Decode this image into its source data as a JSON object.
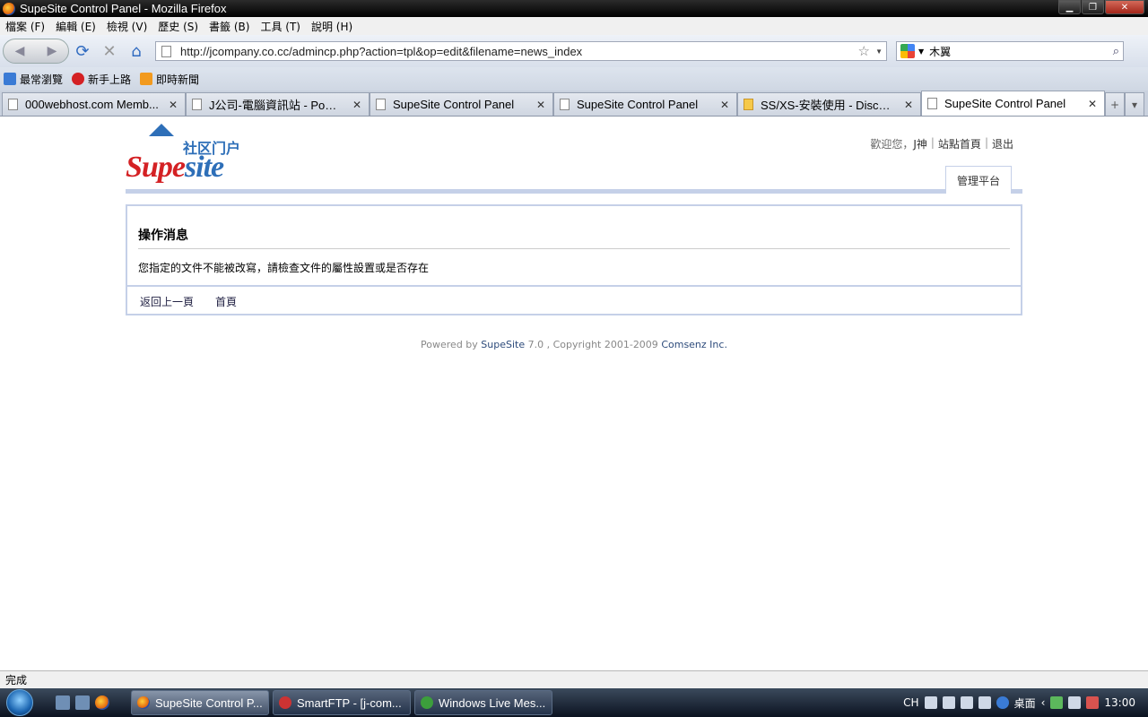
{
  "window": {
    "title": "SupeSite Control Panel - Mozilla Firefox"
  },
  "menu": [
    {
      "label": "檔案 (F)"
    },
    {
      "label": "編輯 (E)"
    },
    {
      "label": "檢視 (V)"
    },
    {
      "label": "歷史 (S)"
    },
    {
      "label": "書籤 (B)"
    },
    {
      "label": "工具 (T)"
    },
    {
      "label": "說明 (H)"
    }
  ],
  "nav": {
    "url": "http://jcompany.co.cc/admincp.php?action=tpl&op=edit&filename=news_index",
    "search_value": "木翼"
  },
  "bookmarks": [
    {
      "label": "最常瀏覽",
      "color": "#3a7bd5"
    },
    {
      "label": "新手上路",
      "color": "#d42124"
    },
    {
      "label": "即時新聞",
      "color": "#f29a1e"
    }
  ],
  "tabs": [
    {
      "label": "000webhost.com Memb..."
    },
    {
      "label": "J公司-電腦資訊站 - Power..."
    },
    {
      "label": "SupeSite Control Panel"
    },
    {
      "label": "SupeSite Control Panel"
    },
    {
      "label": "SS/XS-安裝使用 - Discuz! ..."
    },
    {
      "label": "SupeSite Control Panel"
    }
  ],
  "header": {
    "logo_cn": "社区门户",
    "logo_en_a": "Supe",
    "logo_en_b": "site",
    "welcome": "歡迎您，",
    "username": "J神",
    "home_link": "站點首頁",
    "logout_link": "退出",
    "admin_tab": "管理平台"
  },
  "message": {
    "title": "操作消息",
    "text": "您指定的文件不能被改寫，請檢查文件的屬性設置或是否存在",
    "back_link": "返回上一頁",
    "home_link": "首頁"
  },
  "footer": {
    "powered": "Powered by ",
    "product": "SupeSite",
    "version": " 7.0 , Copyright 2001-2009 ",
    "company": "Comsenz Inc."
  },
  "status": {
    "text": "完成"
  },
  "taskbar": {
    "buttons": [
      {
        "label": "SupeSite Control P...",
        "active": true
      },
      {
        "label": "SmartFTP - [j-com...",
        "active": false
      },
      {
        "label": "Windows Live Mes...",
        "active": false
      }
    ],
    "lang": "CH",
    "desktop": "桌面",
    "clock": "13:00"
  }
}
